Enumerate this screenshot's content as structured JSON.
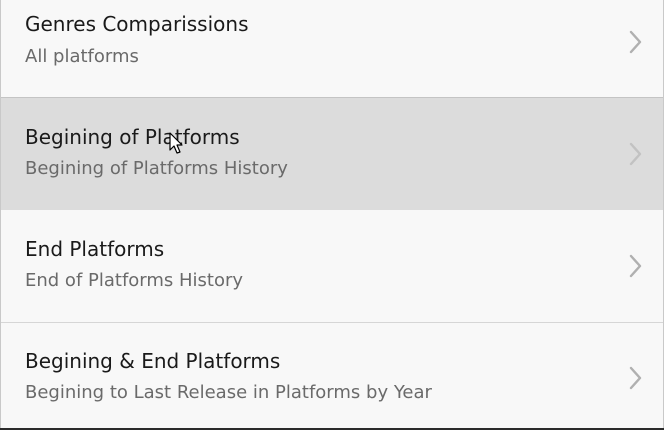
{
  "list": {
    "items": [
      {
        "title": "Genres Comparissions",
        "subtitle": "All platforms",
        "selected": false
      },
      {
        "title": "Begining of Platforms",
        "subtitle": "Begining of Platforms History",
        "selected": true
      },
      {
        "title": "End Platforms",
        "subtitle": "End of Platforms History",
        "selected": false
      },
      {
        "title": "Begining & End Platforms",
        "subtitle": "Begining to Last Release in Platforms by Year",
        "selected": false
      }
    ]
  },
  "icons": {
    "chevron": "chevron-right-icon",
    "cursor": "mouse-pointer-icon"
  },
  "colors": {
    "background": "#f8f8f8",
    "selected_row": "#dcdcdc",
    "title_text": "#1a1a1a",
    "subtitle_text": "#6a6a6a",
    "chevron": "#b0b0b0"
  }
}
